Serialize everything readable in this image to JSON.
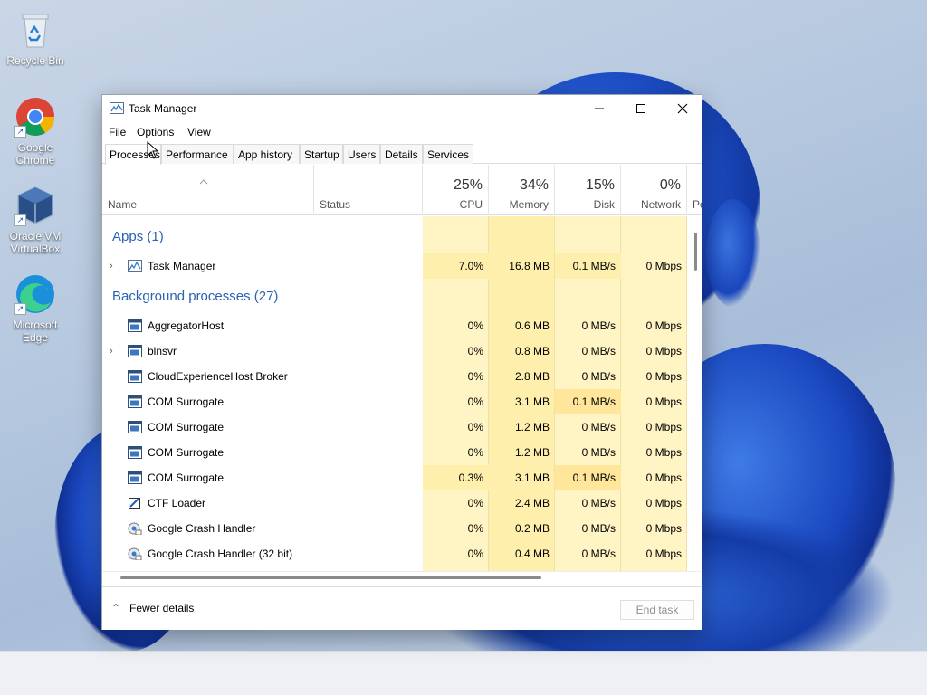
{
  "desktop": {
    "icons": [
      {
        "label_1": "Recycle Bin",
        "label_2": ""
      },
      {
        "label_1": "Google",
        "label_2": "Chrome"
      },
      {
        "label_1": "Oracle VM",
        "label_2": "VirtualBox"
      },
      {
        "label_1": "Microsoft",
        "label_2": "Edge"
      }
    ]
  },
  "window": {
    "title": "Task Manager",
    "menu": [
      "File",
      "Options",
      "View"
    ],
    "tabs": [
      "Processes",
      "Performance",
      "App history",
      "Startup",
      "Users",
      "Details",
      "Services"
    ],
    "active_tab": "Processes",
    "columns": {
      "name": "Name",
      "status": "Status",
      "cpu": {
        "pct": "25%",
        "label": "CPU"
      },
      "memory": {
        "pct": "34%",
        "label": "Memory"
      },
      "disk": {
        "pct": "15%",
        "label": "Disk"
      },
      "network": {
        "pct": "0%",
        "label": "Network"
      },
      "power": "Po"
    },
    "groups": {
      "apps": "Apps (1)",
      "background": "Background processes (27)"
    },
    "apps": [
      {
        "name": "Task Manager",
        "cpu": "7.0%",
        "memory": "16.8 MB",
        "disk": "0.1 MB/s",
        "network": "0 Mbps"
      }
    ],
    "background": [
      {
        "name": "AggregatorHost",
        "cpu": "0%",
        "memory": "0.6 MB",
        "disk": "0 MB/s",
        "network": "0 Mbps"
      },
      {
        "name": "blnsvr",
        "cpu": "0%",
        "memory": "0.8 MB",
        "disk": "0 MB/s",
        "network": "0 Mbps"
      },
      {
        "name": "CloudExperienceHost Broker",
        "cpu": "0%",
        "memory": "2.8 MB",
        "disk": "0 MB/s",
        "network": "0 Mbps"
      },
      {
        "name": "COM Surrogate",
        "cpu": "0%",
        "memory": "3.1 MB",
        "disk": "0.1 MB/s",
        "network": "0 Mbps"
      },
      {
        "name": "COM Surrogate",
        "cpu": "0%",
        "memory": "1.2 MB",
        "disk": "0 MB/s",
        "network": "0 Mbps"
      },
      {
        "name": "COM Surrogate",
        "cpu": "0%",
        "memory": "1.2 MB",
        "disk": "0 MB/s",
        "network": "0 Mbps"
      },
      {
        "name": "COM Surrogate",
        "cpu": "0.3%",
        "memory": "3.1 MB",
        "disk": "0.1 MB/s",
        "network": "0 Mbps"
      },
      {
        "name": "CTF Loader",
        "cpu": "0%",
        "memory": "2.4 MB",
        "disk": "0 MB/s",
        "network": "0 Mbps"
      },
      {
        "name": "Google Crash Handler",
        "cpu": "0%",
        "memory": "0.2 MB",
        "disk": "0 MB/s",
        "network": "0 Mbps"
      },
      {
        "name": "Google Crash Handler (32 bit)",
        "cpu": "0%",
        "memory": "0.4 MB",
        "disk": "0 MB/s",
        "network": "0 Mbps"
      }
    ],
    "footer": {
      "fewer_details": "Fewer details",
      "end_task": "End task"
    }
  },
  "colors": {
    "heat_light": "#fff4c4",
    "heat_mid": "#ffefad",
    "heat_strong": "#f9e595",
    "group_text": "#2a62b4"
  }
}
